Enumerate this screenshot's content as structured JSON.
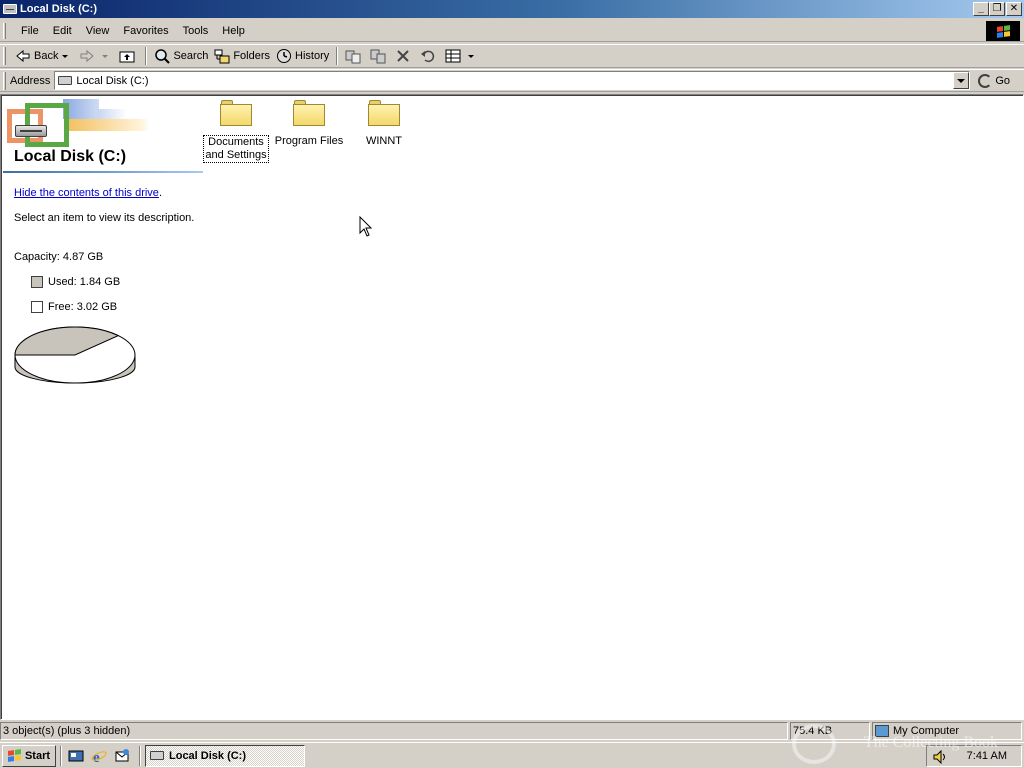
{
  "window": {
    "title": "Local Disk (C:)"
  },
  "menubar": {
    "items": [
      {
        "label": "File"
      },
      {
        "label": "Edit"
      },
      {
        "label": "View"
      },
      {
        "label": "Favorites"
      },
      {
        "label": "Tools"
      },
      {
        "label": "Help"
      }
    ]
  },
  "toolbar": {
    "back_label": "Back",
    "search_label": "Search",
    "folders_label": "Folders",
    "history_label": "History"
  },
  "address": {
    "label": "Address",
    "value": "Local Disk (C:)",
    "go_label": "Go"
  },
  "webview": {
    "drive_title": "Local Disk (C:)",
    "hide_link": "Hide the contents of this drive",
    "hide_link_suffix": ".",
    "select_desc": "Select an item to view its description.",
    "capacity": "Capacity: 4.87 GB",
    "used": "Used: 1.84 GB",
    "free": "Free: 3.02 GB",
    "used_fraction": 0.378
  },
  "folders": [
    {
      "line1": "Documents",
      "line2": "and Settings",
      "icon": "folder-icon",
      "selected": true
    },
    {
      "line1": "Program Files",
      "line2": "",
      "icon": "folder-icon",
      "selected": false
    },
    {
      "line1": "WINNT",
      "line2": "",
      "icon": "folder-icon",
      "selected": false
    }
  ],
  "statusbar": {
    "objects": "3 object(s) (plus 3 hidden)",
    "size": "75.4 KB",
    "zone": "My Computer"
  },
  "taskbar": {
    "start_label": "Start",
    "task_label": "Local Disk (C:)",
    "clock": "7:41 AM"
  },
  "watermark": {
    "text": "The Collecting Book"
  },
  "colors": {
    "title_active": "#0a246a",
    "title_gradient_end": "#a6caf0",
    "face": "#d4d0c8",
    "link": "#0000cc",
    "pie_used": "#c8c4bc",
    "pie_free": "#ffffff"
  }
}
